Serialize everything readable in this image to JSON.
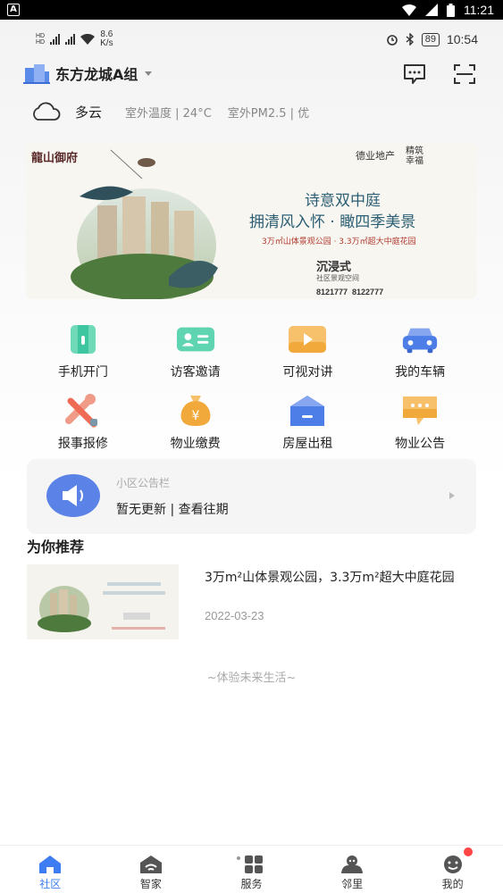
{
  "system_bar": {
    "time": "11:21"
  },
  "status_bar": {
    "speed": "8.6",
    "speed_unit": "K/s",
    "battery": "89",
    "time": "10:54"
  },
  "header": {
    "community_name": "东方龙城A组"
  },
  "weather": {
    "condition": "多云",
    "temperature": "室外温度 | 24°C",
    "pm25": "室外PM2.5 | 优"
  },
  "banner": {
    "brand": "龍山御府",
    "developer": "德业地产",
    "tagline1": "精筑",
    "tagline2": "幸福",
    "headline1": "诗意双中庭",
    "headline2": "拥清风入怀 · 瞰四季美景",
    "subline": "3万㎡山体景观公园 · 3.3万㎡超大中庭花园",
    "showroom": "沉浸式",
    "showroom_sub": "社区景观空间",
    "hotline": "8121777  8122777"
  },
  "quick_actions": [
    {
      "label": "手机开门",
      "icon": "door-icon",
      "color": "#3ec6a0"
    },
    {
      "label": "访客邀请",
      "icon": "visitor-card-icon",
      "color": "#3ec6a0"
    },
    {
      "label": "可视对讲",
      "icon": "video-icon",
      "color": "#f2a93b"
    },
    {
      "label": "我的车辆",
      "icon": "car-icon",
      "color": "#4d7ee8"
    },
    {
      "label": "报事报修",
      "icon": "repair-icon",
      "color": "#ef6b55"
    },
    {
      "label": "物业缴费",
      "icon": "payment-icon",
      "color": "#f2a93b"
    },
    {
      "label": "房屋出租",
      "icon": "house-icon",
      "color": "#4d7ee8"
    },
    {
      "label": "物业公告",
      "icon": "notice-icon",
      "color": "#f2a93b"
    }
  ],
  "notice_board": {
    "title": "小区公告栏",
    "text": "暂无更新 | 查看往期"
  },
  "recommend": {
    "section_title": "为你推荐",
    "items": [
      {
        "title": "3万m²山体景观公园，3.3万m²超大中庭花园",
        "date": "2022-03-23"
      }
    ]
  },
  "slogan": "~体验未来生活~",
  "tabs": [
    {
      "label": "社区",
      "icon": "home-icon",
      "active": true
    },
    {
      "label": "智家",
      "icon": "smart-home-icon",
      "active": false
    },
    {
      "label": "服务",
      "icon": "services-grid-icon",
      "active": false
    },
    {
      "label": "邻里",
      "icon": "neighbors-icon",
      "active": false
    },
    {
      "label": "我的",
      "icon": "profile-icon",
      "active": false
    }
  ]
}
